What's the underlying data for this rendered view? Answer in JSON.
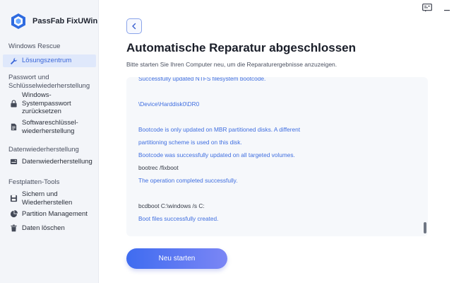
{
  "app": {
    "name": "PassFab FixUWin"
  },
  "colors": {
    "accent": "#3f6ee0",
    "sidebar_bg": "#f3f5f9",
    "log_bg": "#f6f8fb"
  },
  "sidebar": {
    "sections": [
      {
        "title": "Windows Rescue"
      },
      {
        "title": "Passwort und\nSchlüsselwiederherstellung"
      },
      {
        "title": "Datenwiederherstellung"
      },
      {
        "title": "Festplatten-Tools"
      }
    ],
    "items": [
      {
        "label": "Lösungszentrum",
        "icon": "wrench-icon",
        "active": true
      },
      {
        "label": "Windows-\nSystempasswort\nzurücksetzen",
        "icon": "lock-icon"
      },
      {
        "label": "Softwareschlüssel-\nwiederherstellung",
        "icon": "document-icon"
      },
      {
        "label": "Datenwiederherstellung",
        "icon": "drive-icon"
      },
      {
        "label": "Sichern und\nWiederherstellen",
        "icon": "backup-icon"
      },
      {
        "label": "Partition Management",
        "icon": "pie-icon"
      },
      {
        "label": "Daten löschen",
        "icon": "trash-icon"
      }
    ]
  },
  "topbar": {
    "feedback_icon": "feedback-icon"
  },
  "main": {
    "title": "Automatische Reparatur abgeschlossen",
    "subtitle": "Bitte starten Sie Ihren Computer neu, um die Reparaturergebnisse anzuzeigen.",
    "log": [
      {
        "text": "Successfully updated NTFS filesystem bootcode.",
        "style": "blue"
      },
      {
        "text": "",
        "style": "gap"
      },
      {
        "text": "\\Device\\Harddisk0\\DR0",
        "style": "blue"
      },
      {
        "text": "",
        "style": "gap"
      },
      {
        "text": "Bootcode is only updated on MBR partitioned disks.  A different",
        "style": "blue"
      },
      {
        "text": "partitioning scheme is used on this disk.",
        "style": "blue"
      },
      {
        "text": "Bootcode was successfully updated on all targeted volumes.",
        "style": "blue"
      },
      {
        "text": "bootrec /fixboot",
        "style": "dark"
      },
      {
        "text": "The operation completed successfully.",
        "style": "blue"
      },
      {
        "text": "",
        "style": "gap"
      },
      {
        "text": "bcdboot C:\\windows /s C:",
        "style": "dark"
      },
      {
        "text": "Boot files successfully created.",
        "style": "blue"
      }
    ],
    "restart_button": "Neu starten"
  }
}
